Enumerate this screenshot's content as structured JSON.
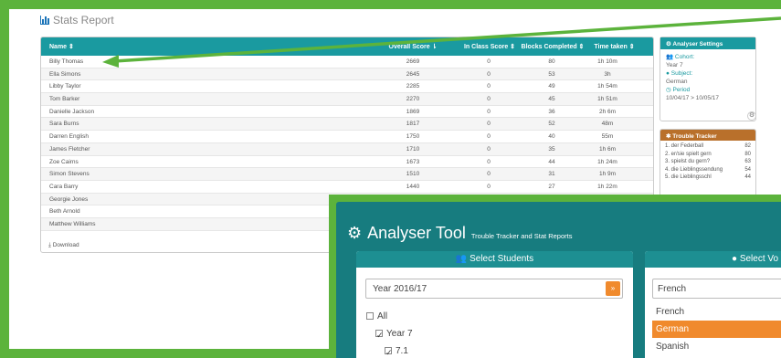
{
  "report": {
    "title": "Stats Report",
    "columns": {
      "name": "Name ⇕",
      "overall": "Overall Score ⇂",
      "in_class": "In Class Score ⇕",
      "blocks": "Blocks Completed ⇕",
      "time": "Time taken ⇕"
    },
    "rows": [
      {
        "name": "Billy Thomas",
        "overall": "2669",
        "in_class": "0",
        "blocks": "80",
        "time": "1h 10m"
      },
      {
        "name": "Ella Simons",
        "overall": "2645",
        "in_class": "0",
        "blocks": "53",
        "time": "3h"
      },
      {
        "name": "Libby Taylor",
        "overall": "2285",
        "in_class": "0",
        "blocks": "49",
        "time": "1h 54m"
      },
      {
        "name": "Tom Barker",
        "overall": "2270",
        "in_class": "0",
        "blocks": "45",
        "time": "1h 51m"
      },
      {
        "name": "Danielle Jackson",
        "overall": "1869",
        "in_class": "0",
        "blocks": "36",
        "time": "2h 6m"
      },
      {
        "name": "Sara Burns",
        "overall": "1817",
        "in_class": "0",
        "blocks": "52",
        "time": "48m"
      },
      {
        "name": "Darren English",
        "overall": "1750",
        "in_class": "0",
        "blocks": "40",
        "time": "55m"
      },
      {
        "name": "James Fletcher",
        "overall": "1710",
        "in_class": "0",
        "blocks": "35",
        "time": "1h 6m"
      },
      {
        "name": "Zoe Cairns",
        "overall": "1673",
        "in_class": "0",
        "blocks": "44",
        "time": "1h 24m"
      },
      {
        "name": "Simon Stevens",
        "overall": "1510",
        "in_class": "0",
        "blocks": "31",
        "time": "1h 9m"
      },
      {
        "name": "Cara Barry",
        "overall": "1440",
        "in_class": "0",
        "blocks": "27",
        "time": "1h 22m"
      },
      {
        "name": "Georgie Jones",
        "overall": "",
        "in_class": "",
        "blocks": "",
        "time": ""
      },
      {
        "name": "Beth Arnold",
        "overall": "",
        "in_class": "",
        "blocks": "",
        "time": ""
      },
      {
        "name": "Matthew Williams",
        "overall": "",
        "in_class": "",
        "blocks": "",
        "time": ""
      }
    ],
    "download": "Download"
  },
  "settings": {
    "title": "Analyser Settings",
    "cohort_label": "Cohort:",
    "cohort_value": "Year 7",
    "subject_label": "Subject:",
    "subject_value": "German",
    "period_label": "Period",
    "period_value": "10/04/17 > 10/05/17"
  },
  "trouble": {
    "title": "Trouble Tracker",
    "items": [
      {
        "label": "1. der Federball",
        "count": "82"
      },
      {
        "label": "2. er/sie spielt gern",
        "count": "80"
      },
      {
        "label": "3. spielst du gern?",
        "count": "63"
      },
      {
        "label": "4. die Lieblingssendung",
        "count": "54"
      },
      {
        "label": "5. die Lieblingsschl",
        "count": "44"
      }
    ]
  },
  "tool": {
    "title": "Analyser Tool",
    "subtitle": "Trouble Tracker and Stat Reports",
    "students_header": "Select Students",
    "year_select": "Year 2016/17",
    "tree": {
      "all": "All",
      "year": "Year 7",
      "class": "7.1"
    },
    "vocab_header": "Select Vo",
    "vocab_select": "French",
    "vocab_options": [
      "French",
      "German",
      "Spanish"
    ]
  },
  "colors": {
    "teal": "#1a9aa0",
    "green_frame": "#5cb33c",
    "orange": "#f08a2d",
    "trouble_brown": "#b9702b"
  }
}
